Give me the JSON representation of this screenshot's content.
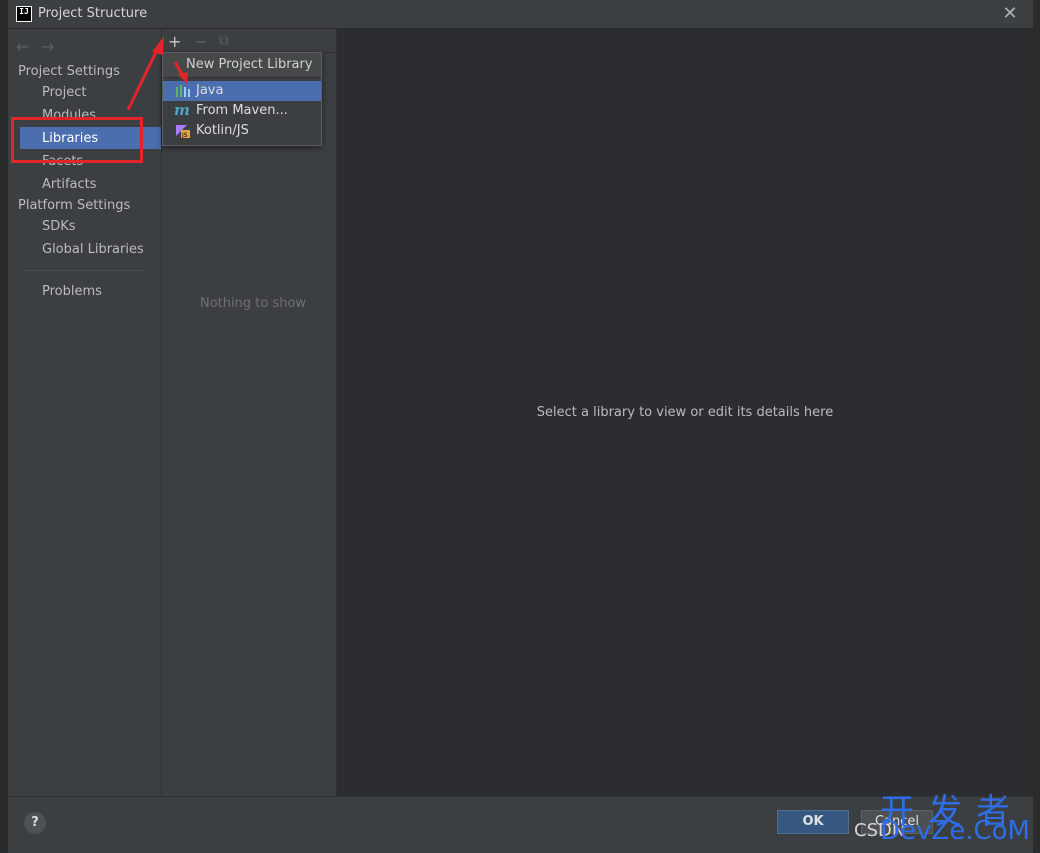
{
  "window": {
    "title": "Project Structure",
    "app_icon_text": "IJ",
    "close_glyph": "✕"
  },
  "sidebar": {
    "project_settings_header": "Project Settings",
    "items": [
      {
        "label": "Project"
      },
      {
        "label": "Modules"
      },
      {
        "label": "Libraries"
      },
      {
        "label": "Facets"
      },
      {
        "label": "Artifacts"
      }
    ],
    "platform_settings_header": "Platform Settings",
    "platform_items": [
      {
        "label": "SDKs"
      },
      {
        "label": "Global Libraries"
      }
    ],
    "problems_label": "Problems",
    "selected": "Libraries"
  },
  "toolbar": {
    "add": "+",
    "remove": "−",
    "copy": "⧉",
    "back": "←",
    "forward": "→"
  },
  "middle": {
    "empty_text": "Nothing to show"
  },
  "popup": {
    "title": "New Project Library",
    "items": [
      {
        "label": "Java",
        "icon": "java-library-icon",
        "selected": true
      },
      {
        "label": "From Maven...",
        "icon": "maven-icon",
        "selected": false
      },
      {
        "label": "Kotlin/JS",
        "icon": "kotlin-js-icon",
        "selected": false
      }
    ]
  },
  "detail": {
    "placeholder": "Select a library to view or edit its details here"
  },
  "buttons": {
    "help": "?",
    "ok": "OK",
    "cancel": "Cancel"
  },
  "watermark": {
    "cn": "开发者",
    "en": "DevZe.CoM",
    "csdn": "CSDN"
  },
  "colors": {
    "selection": "#4b6eaf",
    "annotation": "#e3242b",
    "watermark": "#2e6de8"
  }
}
